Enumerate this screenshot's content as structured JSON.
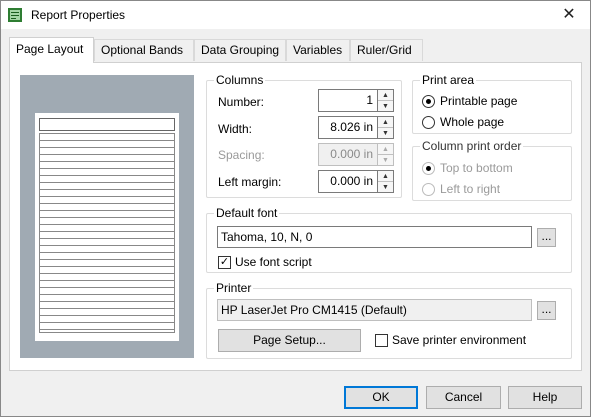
{
  "window": {
    "title": "Report Properties",
    "close_glyph": "✕"
  },
  "tabs": [
    {
      "label": "Page Layout",
      "active": true
    },
    {
      "label": "Optional Bands",
      "active": false
    },
    {
      "label": "Data Grouping",
      "active": false
    },
    {
      "label": "Variables",
      "active": false
    },
    {
      "label": "Ruler/Grid",
      "active": false
    }
  ],
  "columns": {
    "legend": "Columns",
    "number_label": "Number:",
    "number_value": "1",
    "width_label": "Width:",
    "width_value": "8.026 in",
    "spacing_label": "Spacing:",
    "spacing_value": "0.000 in",
    "left_margin_label": "Left margin:",
    "left_margin_value": "0.000 in"
  },
  "print_area": {
    "legend": "Print area",
    "options": [
      "Printable page",
      "Whole page"
    ],
    "selected": "Printable page"
  },
  "column_print_order": {
    "legend": "Column print order",
    "options": [
      "Top to bottom",
      "Left to right"
    ],
    "selected": "Top to bottom"
  },
  "default_font": {
    "legend": "Default font",
    "value": "Tahoma, 10, N, 0",
    "browse_label": "...",
    "use_font_script_label": "Use font script",
    "use_font_script_checked": true
  },
  "printer": {
    "legend": "Printer",
    "value": "HP LaserJet Pro CM1415 (Default)",
    "browse_label": "...",
    "page_setup_label": "Page Setup...",
    "save_env_label": "Save printer environment",
    "save_env_checked": false
  },
  "buttons": {
    "ok": "OK",
    "cancel": "Cancel",
    "help": "Help"
  },
  "icons": {
    "app": "report-icon",
    "close": "close-icon",
    "spin_up": "▲",
    "spin_down": "▼",
    "check": "✓"
  }
}
